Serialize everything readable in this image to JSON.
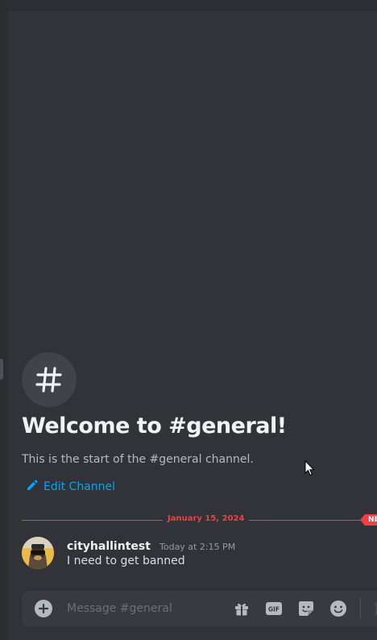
{
  "channel": {
    "welcome_title": "Welcome to #general!",
    "welcome_subtitle": "This is the start of the #general channel.",
    "edit_label": "Edit Channel",
    "hash_glyph": "#"
  },
  "divider": {
    "date": "January 15, 2024",
    "new_label": "NEW"
  },
  "message": {
    "username": "cityhallintest",
    "timestamp": "Today at 2:15 PM",
    "text": "I need to get banned"
  },
  "composer": {
    "placeholder": "Message #general",
    "value": "",
    "gif_label": "GIF"
  },
  "icons": {
    "add": "plus-circle-icon",
    "gift": "gift-icon",
    "gif": "gif-icon",
    "sticker": "sticker-icon",
    "emoji": "emoji-icon",
    "send": "send-icon",
    "edit": "pencil-icon"
  },
  "colors": {
    "background": "#313338",
    "accent_link": "#00a8fc",
    "new_messages": "#f23f43"
  }
}
